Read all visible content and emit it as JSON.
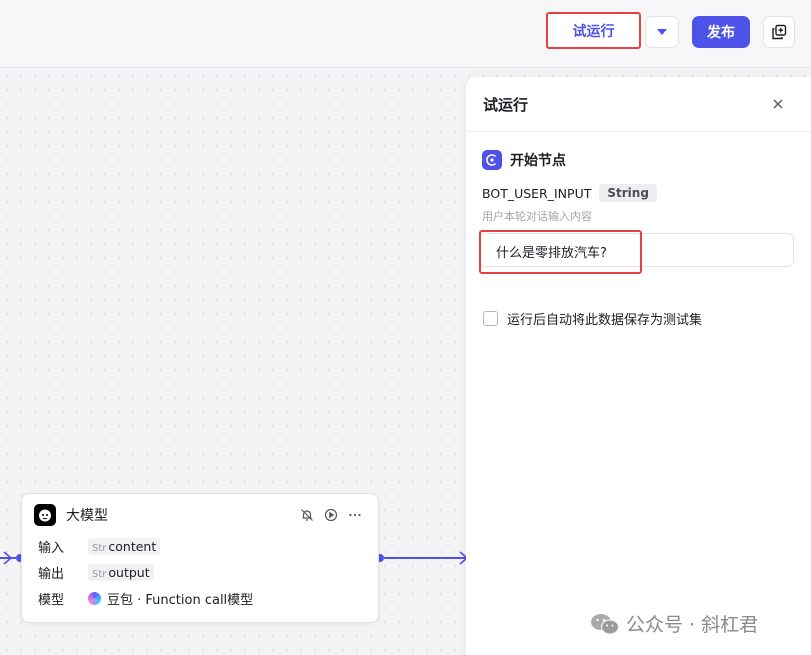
{
  "toolbar": {
    "run_label": "试运行",
    "publish_label": "发布"
  },
  "panel": {
    "title": "试运行",
    "node_name": "开始节点",
    "param_name": "BOT_USER_INPUT",
    "param_type": "String",
    "param_desc": "用户本轮对话输入内容",
    "input_value": "什么是零排放汽车?",
    "checkbox_label": "运行后自动将此数据保存为测试集"
  },
  "llm_node": {
    "title": "大模型",
    "input_label": "输入",
    "input_type": "Str",
    "input_value": "content",
    "output_label": "输出",
    "output_type": "Str",
    "output_value": "output",
    "model_label": "模型",
    "model_value": "豆包 · Function call模型"
  },
  "watermark": {
    "text": "公众号 · 斜杠君"
  },
  "colors": {
    "accent": "#4d53e8",
    "highlight": "#e8413d"
  }
}
